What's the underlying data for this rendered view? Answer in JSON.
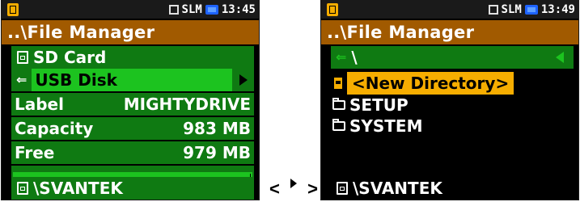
{
  "left": {
    "status": {
      "mode": "SLM",
      "time": "13:45"
    },
    "title": "..\\File Manager",
    "items": [
      {
        "label": "SD Card"
      },
      {
        "label": "USB Disk"
      }
    ],
    "fields": [
      {
        "label": "Label",
        "value": "MIGHTYDRIVE"
      },
      {
        "label": "Capacity",
        "value": "983 MB"
      },
      {
        "label": "Free",
        "value": "979 MB"
      }
    ],
    "free_fraction": 0.996,
    "footer": "\\SVANTEK"
  },
  "right": {
    "status": {
      "mode": "SLM",
      "time": "13:49"
    },
    "title": "..\\File Manager",
    "path": "\\",
    "items": [
      {
        "label": "<New Directory>"
      },
      {
        "label": "SETUP"
      },
      {
        "label": "SYSTEM"
      }
    ],
    "footer": "\\SVANTEK"
  },
  "pager": {
    "prev": "<",
    "next": ">"
  },
  "colors": {
    "title_bg": "#a15a00",
    "row_dark_green": "#0f7a12",
    "row_bright_green": "#1cc31f",
    "selection_amber": "#f6ad00",
    "battery_blue": "#1e63ff"
  }
}
